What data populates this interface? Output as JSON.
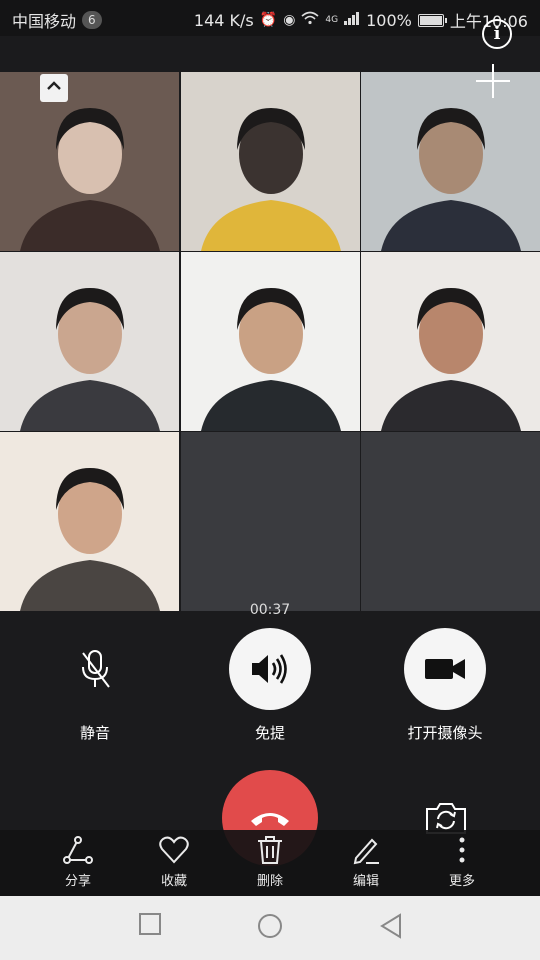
{
  "status_bar": {
    "carrier": "中国移动",
    "notification_count": "6",
    "speed": "144 K/s",
    "network": "4G",
    "battery": "100%",
    "battery_level": 1.0,
    "time": "上午10:06"
  },
  "call": {
    "duration": "00:37",
    "participants": [
      {
        "id": 1,
        "has_video": true,
        "colors": [
          "#6b5a52",
          "#3b2c29",
          "#d8c0b0"
        ]
      },
      {
        "id": 2,
        "has_video": true,
        "colors": [
          "#d8d3cc",
          "#e0b63a",
          "#3b3330"
        ]
      },
      {
        "id": 3,
        "has_video": true,
        "colors": [
          "#bfc4c6",
          "#2b2f3a",
          "#a88a74"
        ]
      },
      {
        "id": 4,
        "has_video": true,
        "colors": [
          "#e3e0dd",
          "#3a3a3f",
          "#caa68f"
        ]
      },
      {
        "id": 5,
        "has_video": true,
        "colors": [
          "#f1f1ef",
          "#262a2e",
          "#c9a184"
        ]
      },
      {
        "id": 6,
        "has_video": true,
        "colors": [
          "#ece9e6",
          "#2b2a2e",
          "#b8866c"
        ]
      },
      {
        "id": 7,
        "has_video": true,
        "colors": [
          "#efe8e0",
          "#4a4542",
          "#cfa58a"
        ]
      },
      {
        "id": 8,
        "has_video": false
      },
      {
        "id": 9,
        "has_video": false
      }
    ]
  },
  "controls": {
    "mute_label": "静音",
    "speaker_label": "免提",
    "camera_label": "打开摄像头"
  },
  "action_bar": {
    "share_label": "分享",
    "favorite_label": "收藏",
    "delete_label": "删除",
    "edit_label": "编辑",
    "more_label": "更多"
  },
  "colors": {
    "hangup": "#e14b4b",
    "background": "#1b1b1d",
    "empty_tile": "#3a3b3f"
  }
}
